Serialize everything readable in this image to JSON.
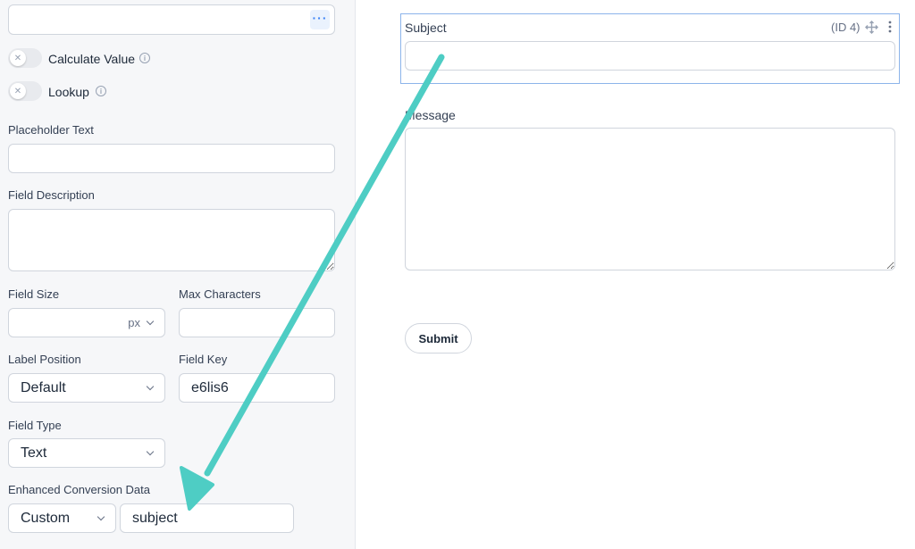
{
  "left_panel": {
    "top_field_value": "",
    "calculate_value_label": "Calculate Value",
    "lookup_label": "Lookup",
    "placeholder_text_label": "Placeholder Text",
    "field_description_label": "Field Description",
    "field_size_label": "Field Size",
    "field_size_unit": "px",
    "max_characters_label": "Max Characters",
    "label_position_label": "Label Position",
    "label_position_value": "Default",
    "field_key_label": "Field Key",
    "field_key_value": "e6lis6",
    "field_type_label": "Field Type",
    "field_type_value": "Text",
    "enhanced_conversion_label": "Enhanced Conversion Data",
    "enhanced_conversion_select": "Custom",
    "enhanced_conversion_value": "subject"
  },
  "form_preview": {
    "subject_label": "Subject",
    "subject_id": "(ID 4)",
    "message_label": "Message",
    "submit_label": "Submit"
  },
  "icons": {
    "more": "more-dots-icon",
    "info": "info-icon",
    "move": "move-icon",
    "menu": "kebab-menu-icon",
    "toggle_off": "x-icon"
  },
  "colors": {
    "accent": "#3b82f6",
    "arrow": "#4ecdc4",
    "selected_border": "#8cb4ea"
  }
}
